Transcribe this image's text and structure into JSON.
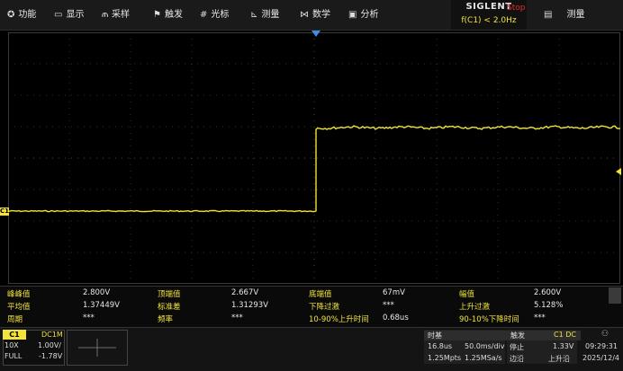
{
  "menu": [
    {
      "icon": "✪",
      "icon_name": "function-icon",
      "label": "功能"
    },
    {
      "icon": "▭",
      "icon_name": "display-icon",
      "label": "显示"
    },
    {
      "icon": "⫙",
      "icon_name": "acquire-icon",
      "label": "采样"
    },
    {
      "icon": "⚑",
      "icon_name": "trigger-flag-icon",
      "label": "触发"
    },
    {
      "icon": "#",
      "icon_name": "cursor-icon",
      "label": "光标"
    },
    {
      "icon": "⊾",
      "icon_name": "measure-icon",
      "label": "测量"
    },
    {
      "icon": "⋈",
      "icon_name": "math-icon",
      "label": "数学"
    },
    {
      "icon": "▣",
      "icon_name": "analysis-icon",
      "label": "分析"
    }
  ],
  "brand": {
    "name": "SIGLENT",
    "run_state": "Stop",
    "trigger_freq": "f(C1) < 2.0Hz"
  },
  "right_menu": {
    "icon": "▤",
    "icon_name": "measure-panel-icon",
    "label": "测量"
  },
  "channel_marker": "C1",
  "measurements": [
    [
      {
        "label": "峰峰值",
        "value": "2.800V"
      },
      {
        "label": "顶端值",
        "value": "2.667V"
      },
      {
        "label": "底端值",
        "value": "67mV"
      },
      {
        "label": "幅值",
        "value": "2.600V"
      }
    ],
    [
      {
        "label": "平均值",
        "value": "1.37449V"
      },
      {
        "label": "标准差",
        "value": "1.31293V"
      },
      {
        "label": "下降过激",
        "value": "***"
      },
      {
        "label": "上升过激",
        "value": "5.128%"
      }
    ],
    [
      {
        "label": "周期",
        "value": "***"
      },
      {
        "label": "频率",
        "value": "***"
      },
      {
        "label": "10-90%上升时间",
        "value": "0.68us"
      },
      {
        "label": "90-10%下降时间",
        "value": "***"
      }
    ]
  ],
  "channel": {
    "name": "C1",
    "coupling": "DC1M",
    "probe": "10X",
    "scale": "1.00V/",
    "bandwidth": "FULL",
    "offset": "-1.78V"
  },
  "timebase": {
    "title": "时基",
    "delay": "16.8us",
    "scale": "50.0ms/div",
    "points": "1.25Mpts",
    "sample_rate": "1.25MSa/s"
  },
  "trigger": {
    "title": "触发",
    "source": "C1 DC",
    "state": "停止",
    "level": "1.33V",
    "type": "边沿",
    "slope": "上升沿"
  },
  "clock": {
    "time": "09:29:31",
    "date": "2025/12/4"
  },
  "colors": {
    "ch1": "#f1e33c",
    "stop": "#e0302a",
    "trigger": "#3d8fe0"
  }
}
